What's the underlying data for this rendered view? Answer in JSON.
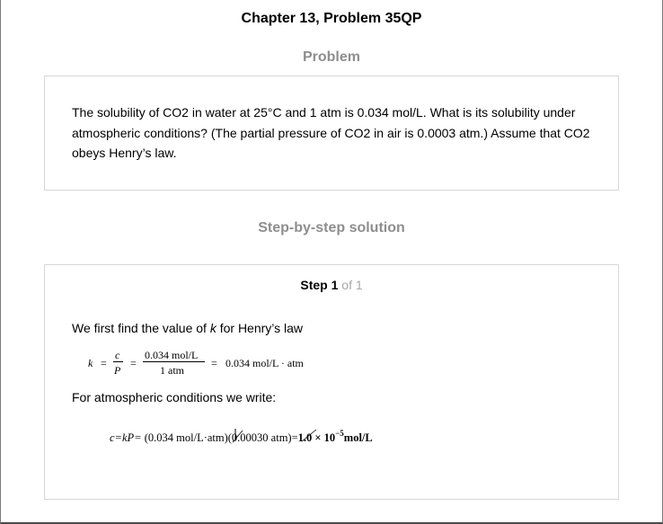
{
  "header": {
    "chapter_title": "Chapter 13, Problem 35QP"
  },
  "problem": {
    "title": "Problem",
    "text": "The solubility of CO2 in water at 25°C and 1 atm is 0.034 mol/L. What is its solubility under atmospheric conditions? (The partial pressure of CO2 in air is 0.0003 atm.) Assume that CO2 obeys Henry’s law."
  },
  "solution": {
    "title": "Step-by-step solution",
    "step": {
      "label": "Step",
      "number": "1",
      "of_text": "of 1",
      "intro_before": "We first find the value of ",
      "intro_var": "k",
      "intro_after": " for Henry’s law",
      "equation1": {
        "lhs": "k",
        "eq1": "=",
        "num1": "c",
        "den1": "P",
        "eq2": "=",
        "num2": "0.034  mol/L",
        "den2": "1 atm",
        "eq3": "=",
        "result": "0.034  mol/L · atm"
      },
      "text2": "For atmospheric conditions we write:",
      "equation2": {
        "lhs": "c=kP=",
        "part1": " (0.034 mol/L·atm)(0.00030 atm)=",
        "result_base": "1.0 × 10",
        "result_exp": "−5",
        "result_unit": "mol/L"
      }
    }
  }
}
